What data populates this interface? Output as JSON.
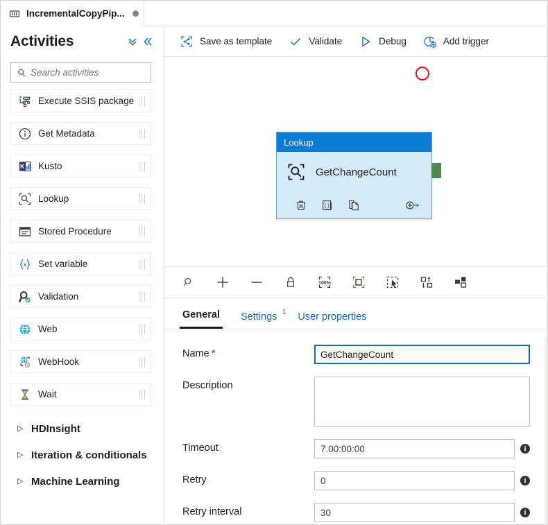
{
  "pipeline_tab": {
    "title": "IncrementalCopyPip...",
    "icon": "pipeline-icon",
    "unsaved_indicator": "●"
  },
  "sidebar": {
    "title": "Activities",
    "controls": [
      {
        "name": "collapse-all-icon",
        "glyph": "chevron-double-down"
      },
      {
        "name": "collapse-panel-icon",
        "glyph": "chevron-double-left"
      }
    ],
    "search": {
      "placeholder": "Search activities",
      "value": "",
      "icon": "search-icon"
    },
    "activities": [
      {
        "label": "Execute SSIS package",
        "icon": "execute-ssis-package-icon"
      },
      {
        "label": "Get Metadata",
        "icon": "get-metadata-icon"
      },
      {
        "label": "Kusto",
        "icon": "kusto-icon"
      },
      {
        "label": "Lookup",
        "icon": "lookup-icon"
      },
      {
        "label": "Stored Procedure",
        "icon": "stored-procedure-icon"
      },
      {
        "label": "Set variable",
        "icon": "set-variable-icon"
      },
      {
        "label": "Validation",
        "icon": "validation-icon"
      },
      {
        "label": "Web",
        "icon": "web-icon"
      },
      {
        "label": "WebHook",
        "icon": "webhook-icon"
      },
      {
        "label": "Wait",
        "icon": "wait-icon"
      }
    ],
    "groups": [
      {
        "label": "HDInsight",
        "expanded": false
      },
      {
        "label": "Iteration & conditionals",
        "expanded": false
      },
      {
        "label": "Machine Learning",
        "expanded": false
      }
    ]
  },
  "command_bar": {
    "items": [
      {
        "label": "Save as template",
        "icon": "save-as-template-icon"
      },
      {
        "label": "Validate",
        "icon": "checkmark-icon"
      },
      {
        "label": "Debug",
        "icon": "play-triangle-icon"
      },
      {
        "label": "Add trigger",
        "icon": "add-trigger-icon"
      }
    ]
  },
  "canvas": {
    "node": {
      "type_label": "Lookup",
      "name": "GetChangeCount",
      "icon": "lookup-icon",
      "actions": [
        {
          "name": "delete-activity-button",
          "icon": "trash-icon"
        },
        {
          "name": "view-code-button",
          "icon": "code-brackets-icon"
        },
        {
          "name": "clone-activity-button",
          "icon": "copy-icon"
        },
        {
          "name": "add-output-connection-button",
          "icon": "plus-arrow-icon"
        }
      ],
      "header_color": "#0c7cd5",
      "body_color": "#d5eaf9"
    },
    "error_indicator": {
      "name": "error-circle-icon",
      "color": "#e81123"
    },
    "output_connector": {
      "name": "success-connector-handle",
      "color": "#4e8a50"
    }
  },
  "canvas_toolbar": {
    "items": [
      {
        "name": "zoom-search-icon",
        "icon": "magnifier"
      },
      {
        "name": "zoom-in-button",
        "icon": "plus"
      },
      {
        "name": "zoom-out-button",
        "icon": "minus"
      },
      {
        "name": "lock-canvas-button",
        "icon": "lock"
      },
      {
        "name": "zoom-100-percent-button",
        "icon": "100pct",
        "label": "100%"
      },
      {
        "name": "zoom-to-fit-button",
        "icon": "fit-square"
      },
      {
        "name": "select-mode-button",
        "icon": "marquee-cursor"
      },
      {
        "name": "auto-align-button",
        "icon": "align-updown"
      },
      {
        "name": "layout-button",
        "icon": "layout-blocks"
      }
    ]
  },
  "properties": {
    "tabs": [
      {
        "label": "General",
        "active": true,
        "badge": ""
      },
      {
        "label": "Settings",
        "active": false,
        "badge": "1"
      },
      {
        "label": "User properties",
        "active": false,
        "badge": ""
      }
    ],
    "fields": [
      {
        "label": "Name",
        "required": true,
        "value": "GetChangeCount",
        "placeholder": "",
        "type": "text",
        "focused": true,
        "info": false
      },
      {
        "label": "Description",
        "required": false,
        "value": "",
        "placeholder": "",
        "type": "textarea",
        "focused": false,
        "info": false
      },
      {
        "label": "Timeout",
        "required": false,
        "value": "7.00:00:00",
        "placeholder": "",
        "type": "text",
        "focused": false,
        "info": true
      },
      {
        "label": "Retry",
        "required": false,
        "value": "0",
        "placeholder": "",
        "type": "text",
        "focused": false,
        "info": true
      },
      {
        "label": "Retry interval",
        "required": false,
        "value": "30",
        "placeholder": "",
        "type": "text",
        "focused": false,
        "info": true
      }
    ],
    "info_glyph": "i"
  },
  "colors": {
    "accent": "#0f6cbd",
    "node_header": "#0c7cd5",
    "error": "#e81123",
    "success": "#4e8a50",
    "required": "#a4262c",
    "badge": "#d13438"
  }
}
